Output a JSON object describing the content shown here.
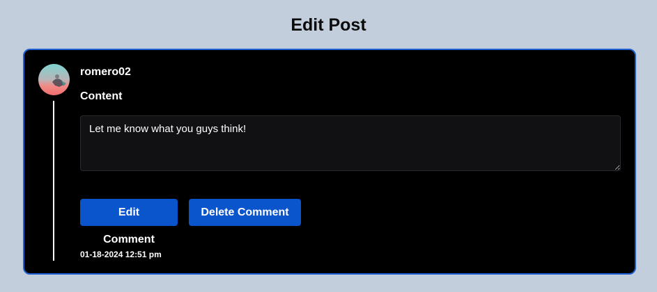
{
  "page": {
    "title": "Edit Post"
  },
  "post": {
    "username": "romero02",
    "content_label": "Content",
    "content_value": "Let me know what you guys think!",
    "timestamp": "01-18-2024 12:51 pm"
  },
  "actions": {
    "edit_label": "Edit Comment",
    "delete_label": "Delete Comment"
  },
  "colors": {
    "page_background": "#c3cedd",
    "card_background": "#000000",
    "card_border": "#1f5fd1",
    "button_primary": "#0b55cc",
    "textarea_background": "#111113"
  },
  "icons": {
    "avatar": "user-avatar-image"
  }
}
